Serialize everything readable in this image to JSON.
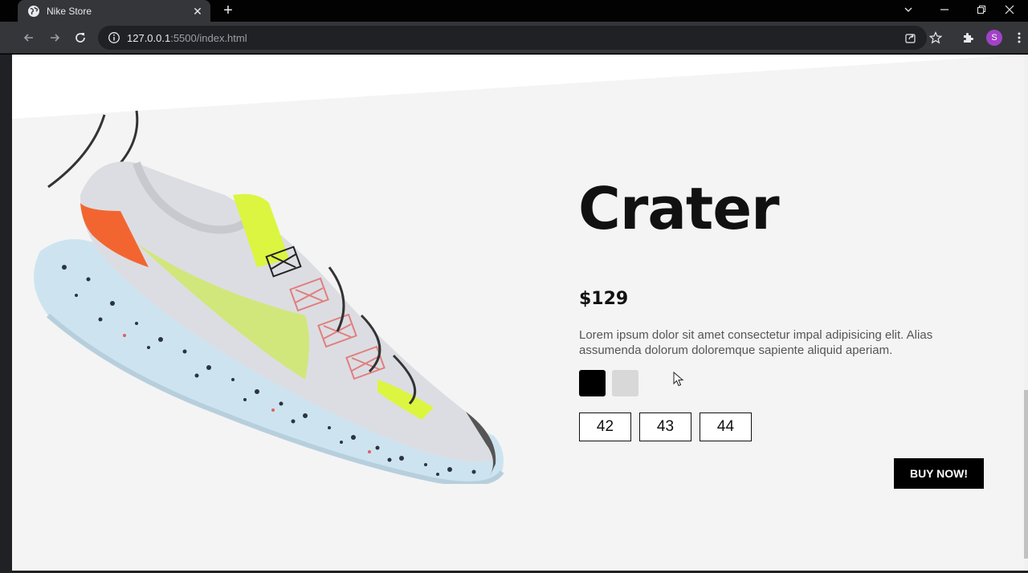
{
  "browser": {
    "tab_title": "Nike Store",
    "url_host": "127.0.0.1",
    "url_path": ":5500/index.html",
    "profile_initial": "S",
    "profile_color": "#a142c8"
  },
  "product": {
    "name": "Crater",
    "price": "$129",
    "description": "Lorem ipsum dolor sit amet consectetur impal adipisicing elit. Alias assumenda dolorum doloremque sapiente aliquid aperiam.",
    "colors": [
      "#000000",
      "#d8d8d8"
    ],
    "sizes": [
      "42",
      "43",
      "44"
    ],
    "buy_label": "BUY NOW!"
  },
  "page": {
    "background_accent": "#f4f4f4"
  }
}
